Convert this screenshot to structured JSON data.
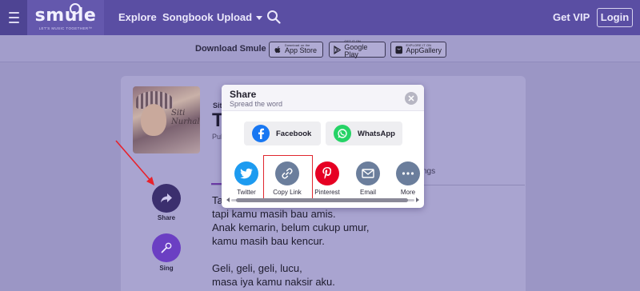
{
  "nav": {
    "logo_word": "smule",
    "logo_tagline": "LET'S MUSIC TOGETHER™",
    "explore": "Explore",
    "songbook": "Songbook",
    "upload": "Upload",
    "get_vip": "Get VIP",
    "login": "Login"
  },
  "download": {
    "title": "Download Smule",
    "stores": [
      {
        "small": "Download on the",
        "big": "App Store",
        "icon": "apple-icon"
      },
      {
        "small": "GET IT ON",
        "big": "Google Play",
        "icon": "google-play-icon"
      },
      {
        "small": "EXPLORE IT ON",
        "big": "AppGallery",
        "icon": "huawei-icon"
      }
    ]
  },
  "song": {
    "artist_prefix": "Siti",
    "title_prefix": "T",
    "published_prefix": "Pul",
    "album_text": "Siti Nurhaliza",
    "tab_partial": "ngs"
  },
  "actions": {
    "share": "Share",
    "sing": "Sing"
  },
  "lyrics": [
    "Ta",
    "tapi kamu masih bau amis.",
    "Anak kemarin, belum cukup umur,",
    "kamu masih bau kencur.",
    "",
    "Geli, geli, geli, lucu,",
    "masa iya kamu naksir aku."
  ],
  "share_dialog": {
    "title": "Share",
    "subtitle": "Spread the word",
    "facebook": "Facebook",
    "whatsapp": "WhatsApp",
    "options": [
      {
        "label": "Twitter",
        "icon": "twitter-icon",
        "color": "#1d9bf0"
      },
      {
        "label": "Copy Link",
        "icon": "link-icon",
        "color": "#6b7e9c"
      },
      {
        "label": "Pinterest",
        "icon": "pinterest-icon",
        "color": "#e60023"
      },
      {
        "label": "Email",
        "icon": "envelope-icon",
        "color": "#6b7e9c"
      },
      {
        "label": "More",
        "icon": "more-dots-icon",
        "color": "#6b7e9c"
      }
    ]
  },
  "colors": {
    "nav_bg": "#5a4ea3",
    "facebook": "#1877f2",
    "whatsapp": "#25d366",
    "highlight_border": "#e0272f",
    "annotation_arrow": "#e8212b"
  }
}
